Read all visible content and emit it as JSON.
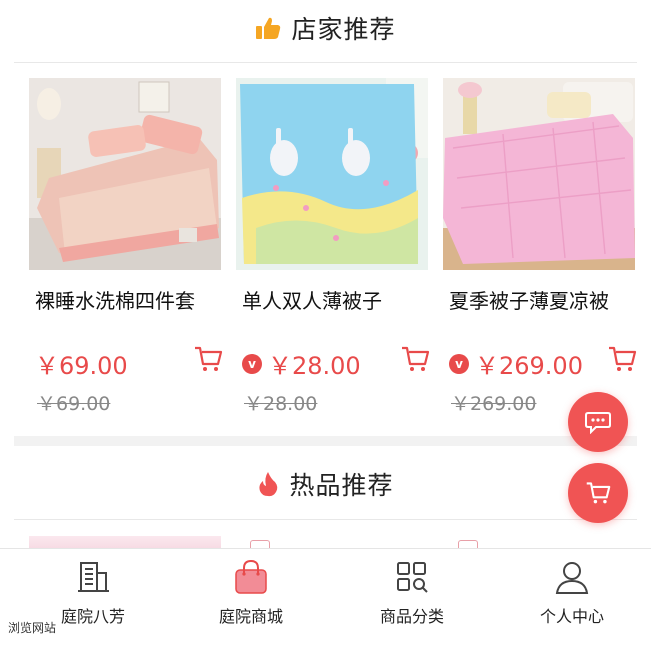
{
  "sections": {
    "shop_recommend": {
      "title": "店家推荐"
    },
    "hot_recommend": {
      "title": "热品推荐"
    }
  },
  "products": [
    {
      "name": "裸睡水洗棉四件套",
      "price": "￥69.00",
      "original_price": "￥69.00",
      "vip_badge": false
    },
    {
      "name": "单人双人薄被子",
      "price": "￥28.00",
      "original_price": "￥28.00",
      "vip_badge": true
    },
    {
      "name": "夏季被子薄夏凉被",
      "price": "￥269.00",
      "original_price": "￥269.00",
      "vip_badge": true
    }
  ],
  "vip_glyph": "v",
  "floating": {
    "chat_icon": "chat-bubble-icon",
    "cart_icon": "cart-icon"
  },
  "tabbar": {
    "items": [
      {
        "label": "庭院八芳",
        "icon": "building-icon",
        "active": false
      },
      {
        "label": "庭院商城",
        "icon": "shopping-bag-icon",
        "active": true
      },
      {
        "label": "商品分类",
        "icon": "category-grid-icon",
        "active": false
      },
      {
        "label": "个人中心",
        "icon": "user-icon",
        "active": false
      }
    ]
  },
  "watermark": "浏览网站",
  "colors": {
    "accent": "#e84a4a",
    "fab": "#f05454",
    "thumb_orange": "#f5a623"
  }
}
